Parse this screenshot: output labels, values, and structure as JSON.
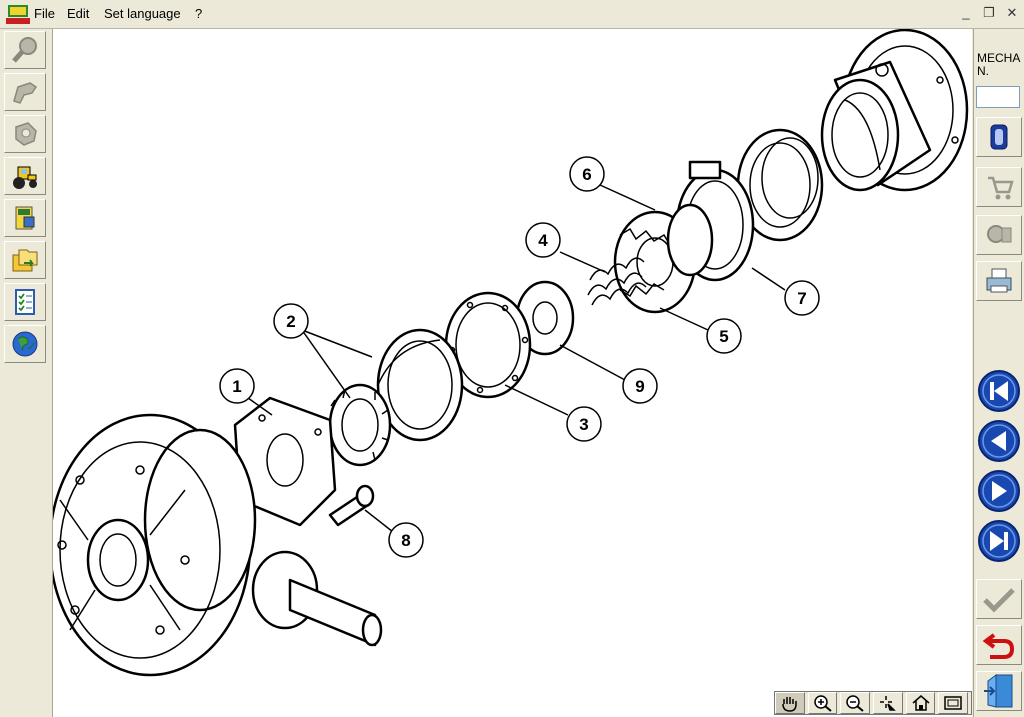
{
  "menu": {
    "items": [
      "File",
      "Edit",
      "Set language",
      "?"
    ],
    "minimize": "_",
    "restore": "❐",
    "close": "✕"
  },
  "left_toolbar": {
    "icons": [
      "search-icon",
      "part-icon",
      "component-icon",
      "tractor-icon",
      "book-icon",
      "folders-icon",
      "checklist-icon",
      "globe-icon"
    ]
  },
  "right_panel": {
    "mech_label": "MECHAN.",
    "mech_value": "",
    "icons": [
      "clip-icon",
      "cart-icon",
      "parts-icon",
      "printer-icon"
    ],
    "nav_icons": [
      "first-page-icon",
      "previous-page-icon",
      "next-page-icon",
      "last-page-icon"
    ],
    "action_icons": [
      "check-icon",
      "undo-icon",
      "exit-icon"
    ]
  },
  "diagram": {
    "callouts": [
      "1",
      "2",
      "3",
      "4",
      "5",
      "6",
      "7",
      "8",
      "9"
    ]
  },
  "bottom_toolbar": {
    "icons": [
      "hand-icon",
      "zoom-in-icon",
      "zoom-out-icon",
      "select-icon",
      "home-icon",
      "fit-window-icon"
    ]
  },
  "colors": {
    "chrome": "#ece9d8",
    "nav_blue": "#1848b0",
    "undo_red": "#cc1111",
    "canvas": "#ffffff"
  }
}
